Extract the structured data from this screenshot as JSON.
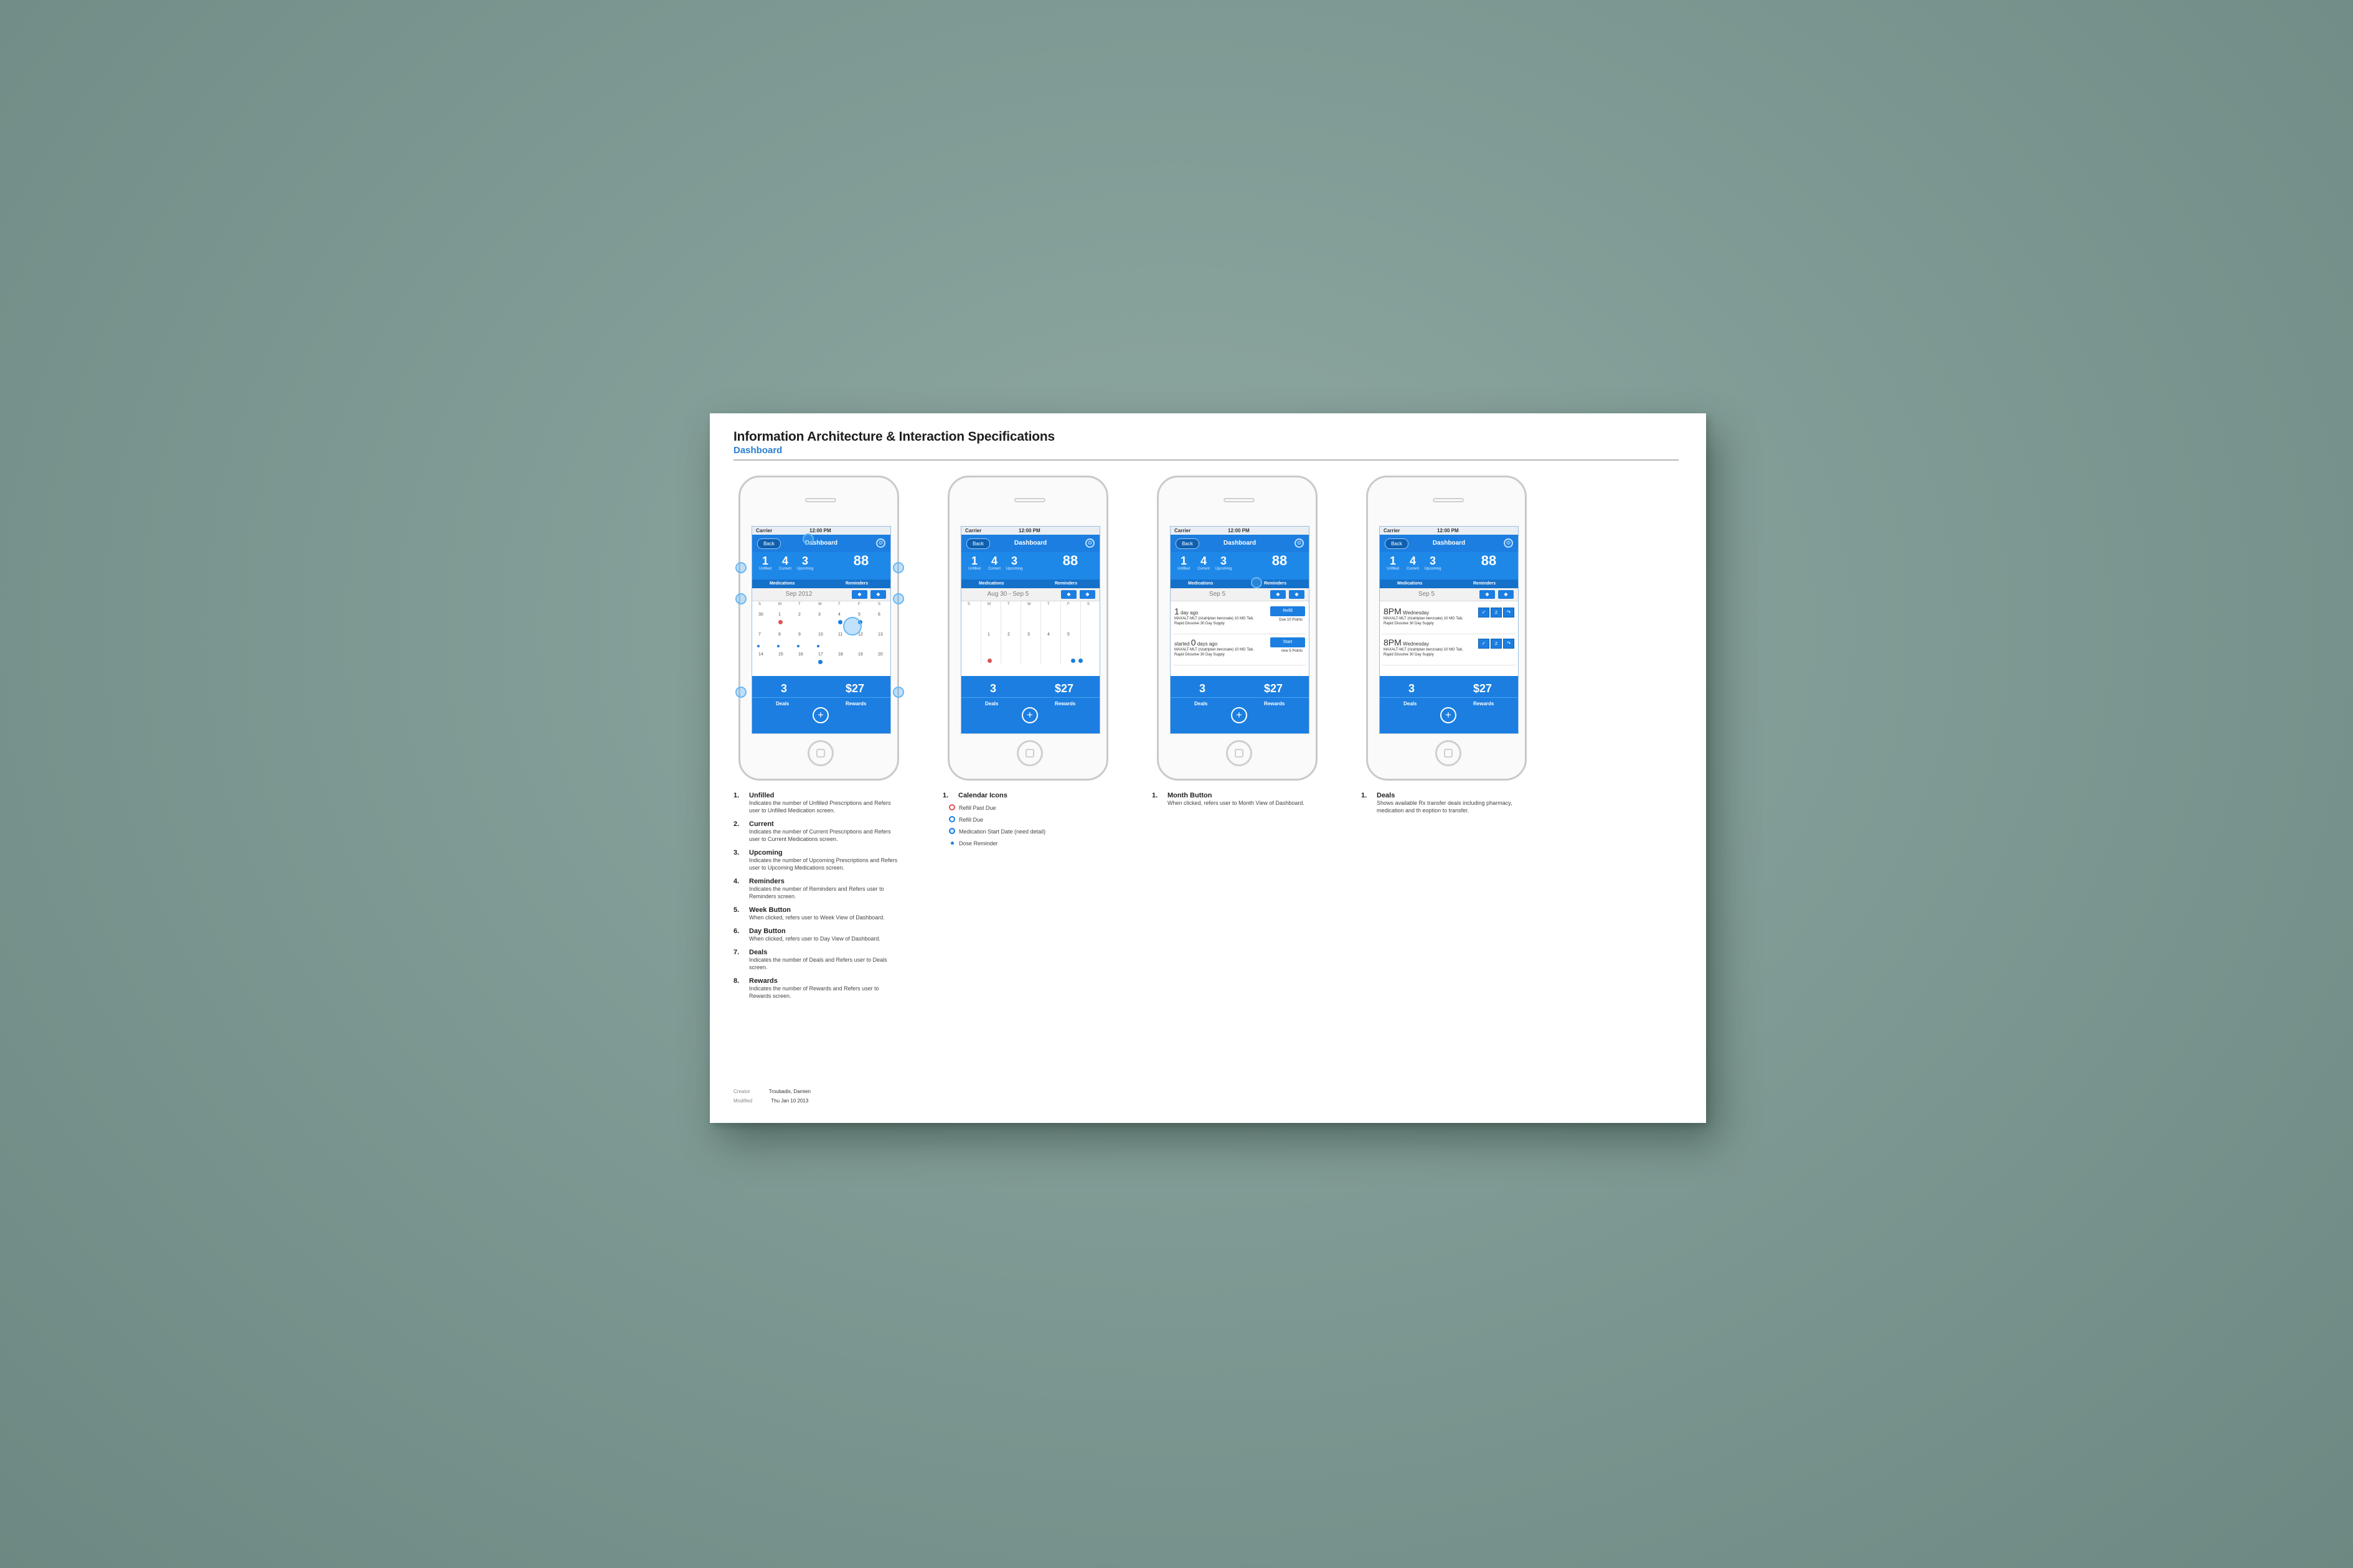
{
  "doc": {
    "title": "Information Architecture & Interaction Specifications",
    "subtitle": "Dashboard"
  },
  "phone": {
    "carrier": "Carrier",
    "time": "12:00 PM",
    "back": "Back",
    "title": "Dashboard",
    "stats": [
      {
        "num": "1",
        "label": "Unfilled"
      },
      {
        "num": "4",
        "label": "Current"
      },
      {
        "num": "3",
        "label": "Upcoming"
      }
    ],
    "reminders_count": "88",
    "tab_medications": "Medications",
    "tab_reminders": "Reminders",
    "deals_count": "3",
    "rewards_amount": "$27",
    "deals_label": "Deals",
    "rewards_label": "Rewards",
    "plus": "+",
    "dow": [
      "S",
      "M",
      "T",
      "W",
      "T",
      "F",
      "S"
    ]
  },
  "screens": {
    "month_period": "Sep 2012",
    "week_period": "Aug 30 - Sep 5",
    "day_period": "Sep 5",
    "week_days": [
      "1",
      "2",
      "3",
      "4",
      "5"
    ],
    "reminders": [
      {
        "when_num": "1",
        "when_text": "day ago",
        "med": "MAXALT-MLT (rizatriptan benzoate) 10 MG Tab, Rapid Dissolve 30 Day Supply",
        "action": "Refill",
        "meta": "Due 10 Points"
      },
      {
        "when_num": "0",
        "when_prefix": "started",
        "when_text": "days ago",
        "med": "MAXALT-MLT (rizatriptan benzoate) 10 MG Tab, Rapid Dissolve 30 Day Supply",
        "action": "Start",
        "meta": "now 5 Points"
      }
    ],
    "doses": [
      {
        "hour": "8PM",
        "day": "Wednesday",
        "med": "MAXALT-MLT (rizatriptan benzoate) 10 MG Tab, Rapid Dissolve 30 Day Supply"
      },
      {
        "hour": "8PM",
        "day": "Wednesday",
        "med": "MAXALT-MLT (rizatriptan benzoate) 10 MG Tab, Rapid Dissolve 30 Day Supply"
      }
    ]
  },
  "specs": {
    "col1": [
      {
        "n": "1.",
        "t": "Unfilled",
        "d": "Indicates the number of Unfilled Prescriptions and Refers user to Unfilled Medication screen."
      },
      {
        "n": "2.",
        "t": "Current",
        "d": "Indicates the number of Current Prescriptions and Refers user to Current Medications screen."
      },
      {
        "n": "3.",
        "t": "Upcoming",
        "d": "Indicates the number of Upcoming Prescriptions and Refers user to Upcoming Medications screen."
      },
      {
        "n": "4.",
        "t": "Reminders",
        "d": "Indicates the number of Reminders and Refers user to Reminders screen."
      },
      {
        "n": "5.",
        "t": "Week Button",
        "d": "When clicked, refers user to Week View of Dashboard."
      },
      {
        "n": "6.",
        "t": "Day Button",
        "d": "When clicked, refers user to Day View of Dashboard."
      },
      {
        "n": "7.",
        "t": "Deals",
        "d": "Indicates the number of Deals and Refers user to Deals screen."
      },
      {
        "n": "8.",
        "t": "Rewards",
        "d": "Indicates the number of Rewards and Refers user to Rewards screen."
      }
    ],
    "col2": {
      "n": "1.",
      "t": "Calendar Icons",
      "legend": [
        "Refill Past Due",
        "Refill Due",
        "Medication Start Date (need detail)",
        "Dose Reminder"
      ]
    },
    "col3": {
      "n": "1.",
      "t": "Month Button",
      "d": "When clicked, refers user to Month View of Dashboard."
    },
    "col4": {
      "n": "1.",
      "t": "Deals",
      "d": "Shows available Rx transfer deals including pharmacy, medication and th eoption to transfer."
    }
  },
  "footer": {
    "created_label": "Creator",
    "created_value": "Troubadix, Damien",
    "modified_label": "Modified",
    "modified_value": "Thu Jan 10 2013"
  },
  "colors": {
    "accent": "#1b7ee0",
    "past_due": "#e05555",
    "background": "#7f9a94"
  }
}
